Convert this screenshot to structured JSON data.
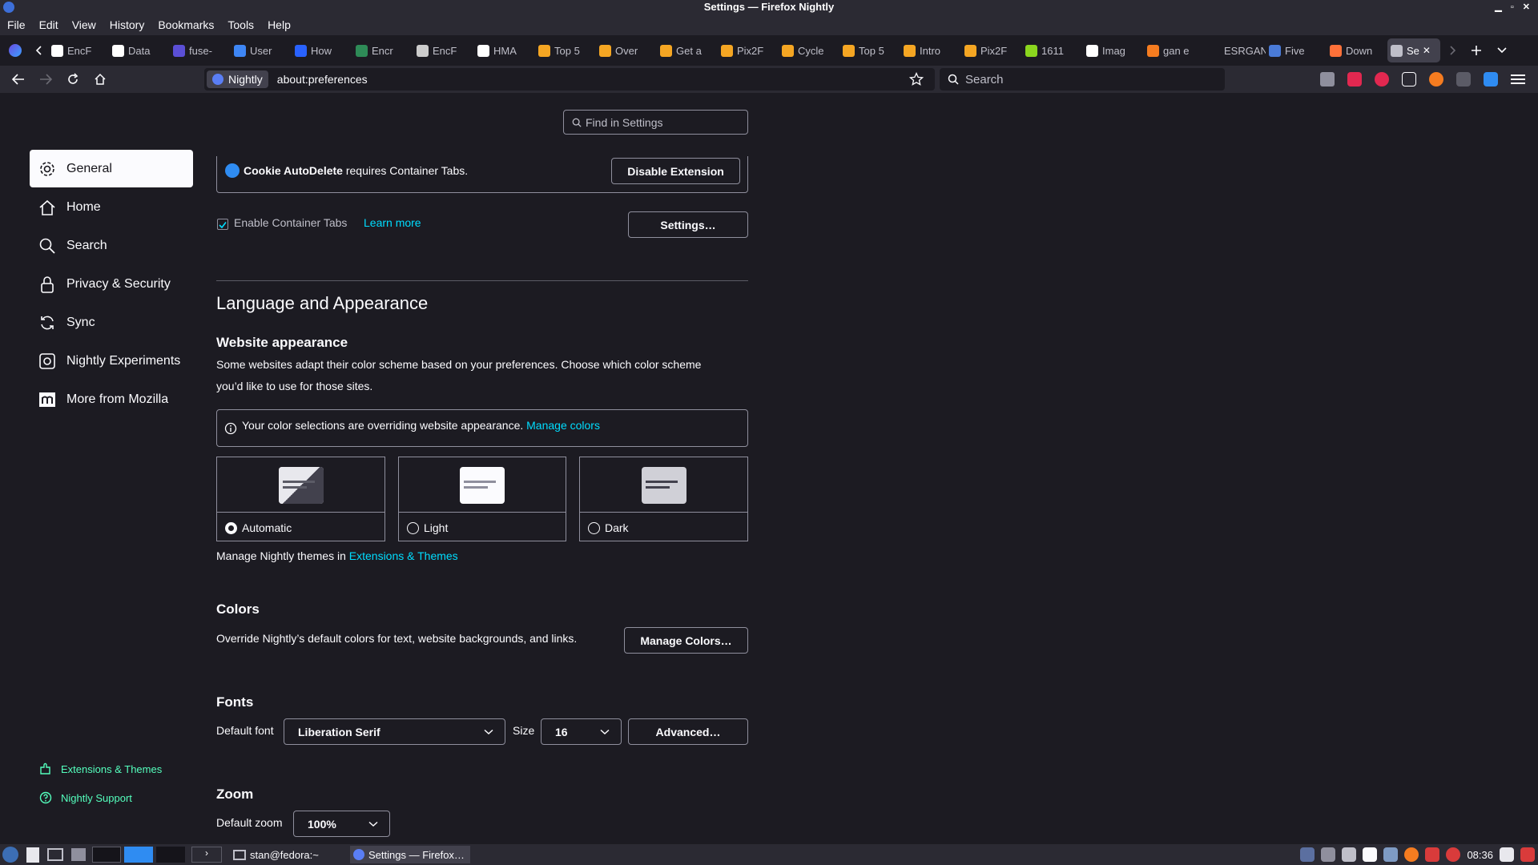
{
  "window": {
    "title": "Settings — Firefox Nightly"
  },
  "menubar": {
    "items": [
      "File",
      "Edit",
      "View",
      "History",
      "Bookmarks",
      "Tools",
      "Help"
    ]
  },
  "tabs": [
    {
      "label": "EncF",
      "icon": "wikipedia-icon",
      "color": "#ffffff"
    },
    {
      "label": "Data",
      "icon": "wikipedia-icon",
      "color": "#ffffff"
    },
    {
      "label": "fuse-",
      "icon": "binoculars-icon",
      "color": "#5b4fd6"
    },
    {
      "label": "User",
      "icon": "document-icon",
      "color": "#3e86f5"
    },
    {
      "label": "How",
      "icon": "hashnode-icon",
      "color": "#2962ff"
    },
    {
      "label": "Encr",
      "icon": "key-icon",
      "color": "#2e8b57"
    },
    {
      "label": "EncF",
      "icon": "code-icon",
      "color": "#cccccc"
    },
    {
      "label": "HMA",
      "icon": "wikipedia-icon",
      "color": "#ffffff"
    },
    {
      "label": "Top 5",
      "icon": "paperswithcode-icon",
      "color": "#f5a623"
    },
    {
      "label": "Over",
      "icon": "paperswithcode-icon",
      "color": "#f5a623"
    },
    {
      "label": "Get a",
      "icon": "paperswithcode-icon",
      "color": "#f5a623"
    },
    {
      "label": "Pix2F",
      "icon": "paperswithcode-icon",
      "color": "#f5a623"
    },
    {
      "label": "Cycle",
      "icon": "paperswithcode-icon",
      "color": "#f5a623"
    },
    {
      "label": "Top 5",
      "icon": "paperswithcode-icon",
      "color": "#f5a623"
    },
    {
      "label": "Intro",
      "icon": "paperswithcode-icon",
      "color": "#f5a623"
    },
    {
      "label": "Pix2F",
      "icon": "paperswithcode-icon",
      "color": "#f5a623"
    },
    {
      "label": "1611",
      "icon": "arxiv-icon",
      "color": "#8bd61e"
    },
    {
      "label": "Imag",
      "icon": "sparkle-icon",
      "color": "#ffffff"
    },
    {
      "label": "gan e",
      "icon": "brave-icon",
      "color": "#f57c20"
    },
    {
      "label": "ESRGAN",
      "icon": "blank-icon",
      "color": "#1c1b22"
    },
    {
      "label": "Five",
      "icon": "dev-icon",
      "color": "#4a7bd8"
    },
    {
      "label": "Down",
      "icon": "firefox-icon",
      "color": "#ff7139"
    },
    {
      "label": "Se",
      "icon": "gear-icon",
      "color": "#bfbfc9"
    }
  ],
  "urlbar": {
    "badge": "Nightly",
    "url": "about:preferences"
  },
  "searchbar": {
    "placeholder": "Search"
  },
  "find": {
    "placeholder": "Find in Settings"
  },
  "sidebar": {
    "items": [
      {
        "label": "General",
        "icon": "gear-icon"
      },
      {
        "label": "Home",
        "icon": "home-icon"
      },
      {
        "label": "Search",
        "icon": "search-icon"
      },
      {
        "label": "Privacy & Security",
        "icon": "lock-icon"
      },
      {
        "label": "Sync",
        "icon": "sync-icon"
      },
      {
        "label": "Nightly Experiments",
        "icon": "experiments-icon"
      },
      {
        "label": "More from Mozilla",
        "icon": "mozilla-icon"
      }
    ],
    "footer": [
      {
        "label": "Extensions & Themes",
        "icon": "puzzle-icon"
      },
      {
        "label": "Nightly Support",
        "icon": "help-icon"
      }
    ]
  },
  "containers": {
    "ext_name": "Cookie AutoDelete",
    "ext_msg": " requires Container Tabs.",
    "disable_btn": "Disable Extension",
    "enable_label": "Enable Container Tabs",
    "enable_checked": true,
    "learn_more": "Learn more",
    "settings_btn": "Settings…"
  },
  "language": {
    "heading": "Language and Appearance",
    "website_appearance": "Website appearance",
    "desc_line1": "Some websites adapt their color scheme based on your preferences. Choose which color scheme",
    "desc_line2": "you’d like to use for those sites.",
    "override_msg": "Your color selections are overriding website appearance.",
    "manage_colors_link": "Manage colors",
    "options": [
      {
        "label": "Automatic",
        "selected": true
      },
      {
        "label": "Light",
        "selected": false
      },
      {
        "label": "Dark",
        "selected": false
      }
    ],
    "themes_text": "Manage Nightly themes in ",
    "themes_link": "Extensions & Themes"
  },
  "colors": {
    "heading": "Colors",
    "desc": "Override Nightly’s default colors for text, website backgrounds, and links.",
    "button": "Manage Colors…"
  },
  "fonts": {
    "heading": "Fonts",
    "default_font_label": "Default font",
    "default_font_value": "Liberation Serif",
    "size_label": "Size",
    "size_value": "16",
    "advanced_btn": "Advanced…"
  },
  "zoom": {
    "heading": "Zoom",
    "default_zoom_label": "Default zoom",
    "default_zoom_value": "100%"
  },
  "taskbar": {
    "terminal_label": "stan@fedora:~",
    "firefox_label": "Settings — Firefox…",
    "clock": "08:36"
  },
  "theme": {
    "accent": "#00ddff",
    "bg": "#1c1b22",
    "chrome": "#2b2a33",
    "green": "#54ffbd"
  }
}
